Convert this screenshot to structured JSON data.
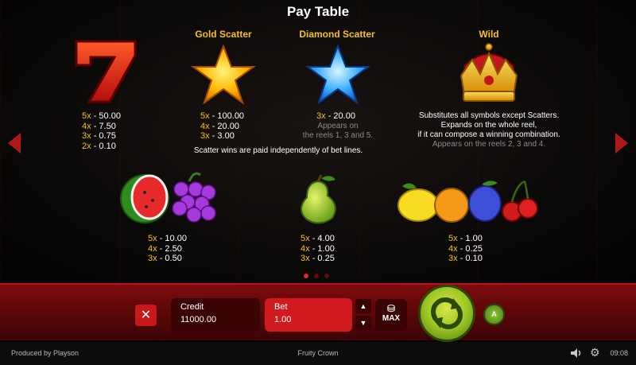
{
  "title": "Pay Table",
  "heads": {
    "gold_scatter": "Gold Scatter",
    "diamond_scatter": "Diamond Scatter",
    "wild": "Wild"
  },
  "seven": {
    "pays": [
      [
        "5x",
        "- 50.00"
      ],
      [
        "4x",
        "- 7.50"
      ],
      [
        "3x",
        "- 0.75"
      ],
      [
        "2x",
        "- 0.10"
      ]
    ]
  },
  "gold": {
    "pays": [
      [
        "5x",
        "- 100.00"
      ],
      [
        "4x",
        "- 20.00"
      ],
      [
        "3x",
        "- 3.00"
      ]
    ]
  },
  "diamond": {
    "pays": [
      [
        "3x",
        "- 20.00"
      ]
    ],
    "note_line1": "Appears on",
    "note_line2": "the reels 1, 3 and 5."
  },
  "scatter_note": "Scatter wins are paid independently of bet lines.",
  "wild": {
    "line1": "Substitutes all symbols except Scatters.",
    "line2": "Expands on the whole reel,",
    "line3": "if it can compose a winning combination.",
    "line4": "Appears on the reels 2, 3 and 4."
  },
  "melon_grapes": {
    "pays": [
      [
        "5x",
        "- 10.00"
      ],
      [
        "4x",
        "- 2.50"
      ],
      [
        "3x",
        "- 0.50"
      ]
    ]
  },
  "pear": {
    "pays": [
      [
        "5x",
        "- 4.00"
      ],
      [
        "4x",
        "- 1.00"
      ],
      [
        "3x",
        "- 0.25"
      ]
    ]
  },
  "lemon_group": {
    "pays": [
      [
        "5x",
        "- 1.00"
      ],
      [
        "4x",
        "- 0.25"
      ],
      [
        "3x",
        "- 0.10"
      ]
    ]
  },
  "pager": {
    "count": 3,
    "active": 0
  },
  "panel": {
    "credit_label": "Credit",
    "credit_value": "11000.00",
    "bet_label": "Bet",
    "bet_value": "1.00",
    "max_label": "MAX",
    "close_glyph": "✕",
    "up_glyph": "▲",
    "down_glyph": "▼",
    "auto_glyph": "A"
  },
  "footer": {
    "provider": "Produced by Playson",
    "game_name": "Fruity Crown",
    "time": "09:08"
  },
  "colors": {
    "accent_gold": "#f4c21b",
    "panel_red": "#7d0b0d",
    "spin_green": "#9dc624"
  }
}
